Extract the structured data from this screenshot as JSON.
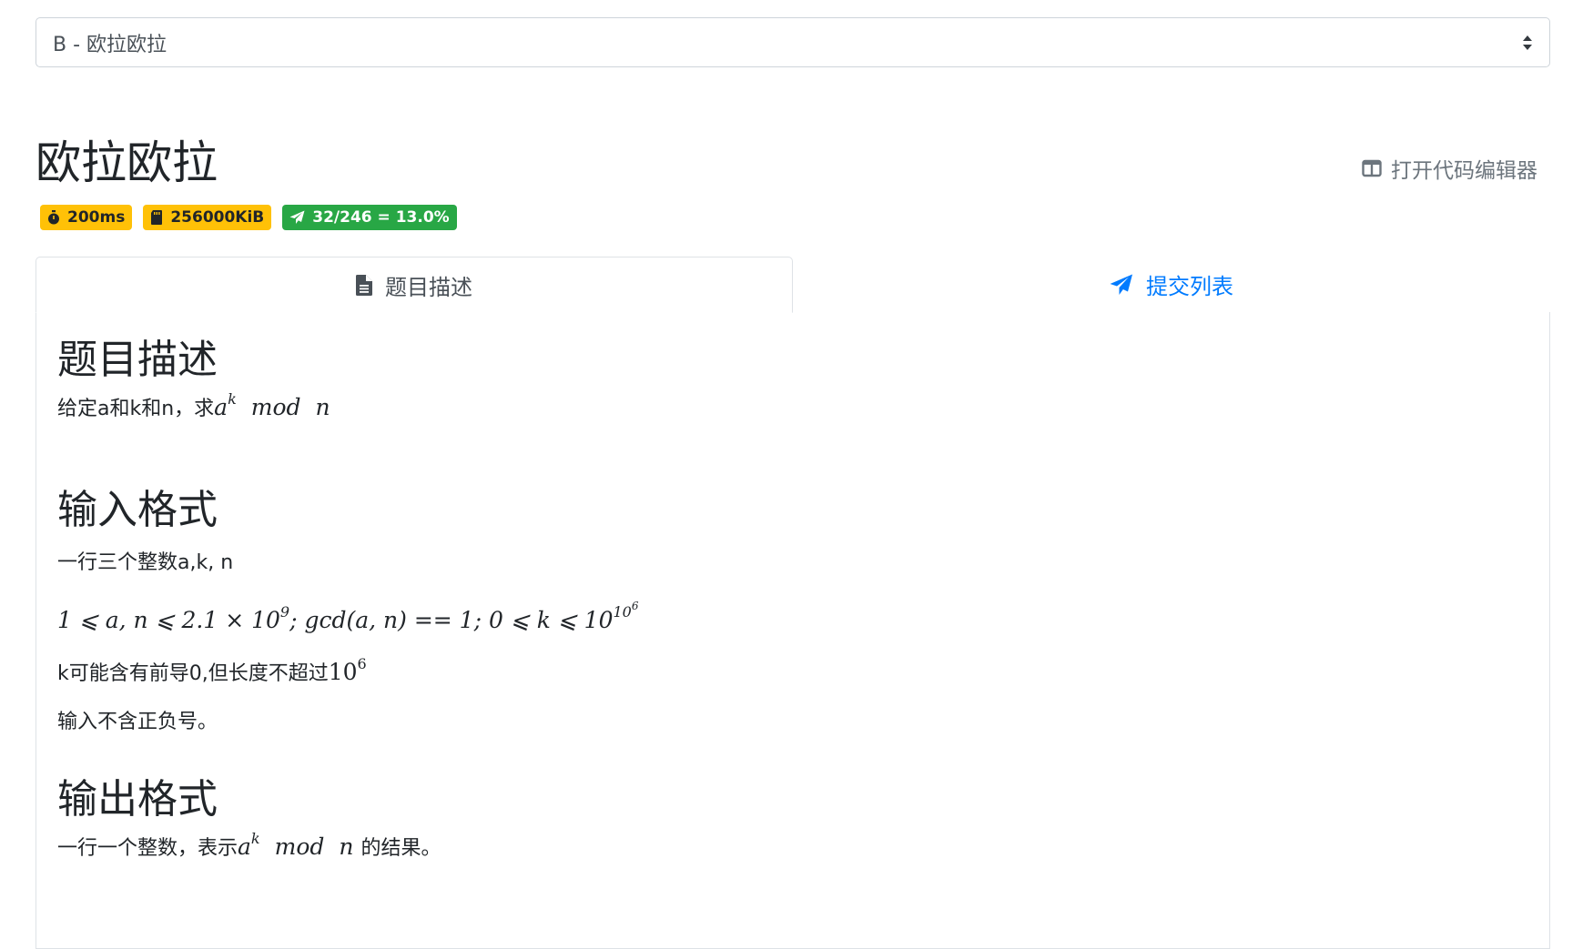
{
  "problem_select": {
    "value": "B - 欧拉欧拉"
  },
  "title": "欧拉欧拉",
  "editor_link": {
    "label": "打开代码编辑器"
  },
  "badges": {
    "time": "200ms",
    "memory": "256000KiB",
    "accept": "32/246 = 13.0%"
  },
  "tabs": {
    "description": "题目描述",
    "submissions": "提交列表"
  },
  "sections": {
    "description": {
      "heading": "题目描述",
      "text": "给定a和k和n，求",
      "math_base": "a",
      "math_exp": "k",
      "math_mod": "mod",
      "math_n": "n"
    },
    "input": {
      "heading": "输入格式",
      "line1": "一行三个整数a,k, n",
      "constraint": "1 ⩽ a, n ⩽ 2.1 × 10",
      "constraint_exp1": "9",
      "constraint_mid": "; gcd(a, n) == 1; 0 ⩽ k ⩽ 10",
      "constraint_exp2": "10",
      "constraint_exp3": "6",
      "line3_text": "k可能含有前导0,但长度不超过",
      "line3_base": "10",
      "line3_exp": "6",
      "line4": "输入不含正负号。"
    },
    "output": {
      "heading": "输出格式",
      "text_before": "一行一个整数，表示",
      "math_base": "a",
      "math_exp": "k",
      "math_mod": "mod",
      "math_n": "n",
      "text_after": "的结果。"
    }
  },
  "colors": {
    "badge_warn": "#ffc107",
    "badge_ok": "#28a745",
    "link_blue": "#007bff"
  }
}
